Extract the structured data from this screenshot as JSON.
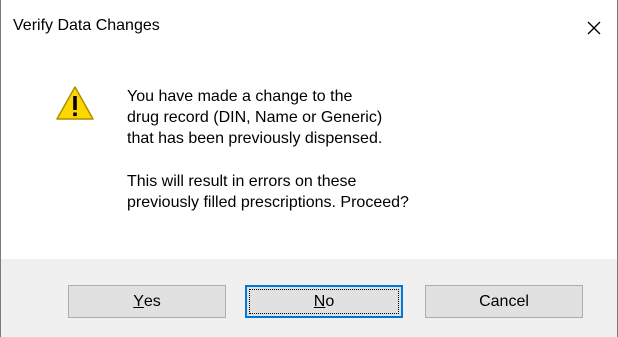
{
  "window": {
    "title": "Verify Data Changes"
  },
  "icons": {
    "close": "close-icon",
    "warning": "warning-icon"
  },
  "message": {
    "line1": "You have made a change to the",
    "line2": "drug record (DIN, Name or Generic)",
    "line3": "that has been previously dispensed.",
    "line4": "This will result in errors on these",
    "line5": "previously filled prescriptions. Proceed?"
  },
  "buttons": {
    "yes": {
      "mnemonic": "Y",
      "rest": "es"
    },
    "no": {
      "mnemonic": "N",
      "rest": "o"
    },
    "cancel": {
      "label": "Cancel"
    }
  },
  "colors": {
    "warning_fill": "#ffd700",
    "focus_border": "#0078d7",
    "footer_bg": "#f0f0f0"
  }
}
